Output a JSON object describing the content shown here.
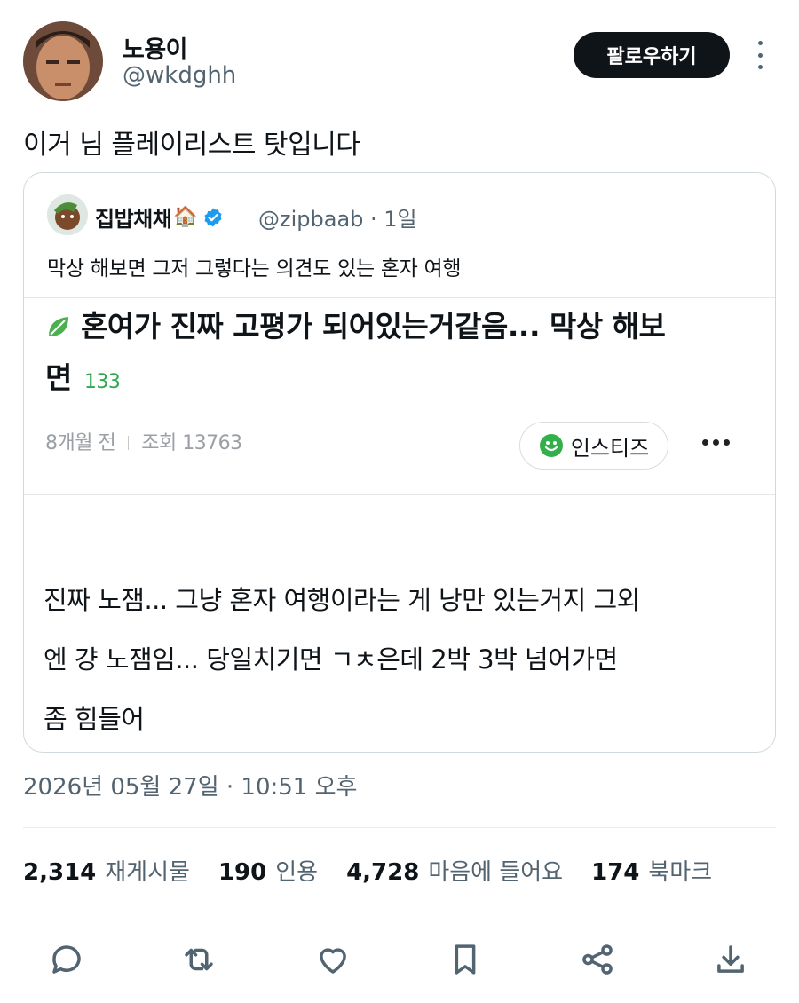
{
  "author": {
    "display_name": "노용이",
    "handle": "@wkdghh",
    "follow_label": "팔로우하기"
  },
  "tweet": {
    "text": "이거 님 플레이리스트 탓입니다",
    "timestamp": "2026년 05월 27일 · 10:51 오후"
  },
  "quote": {
    "display_name": "집밥채채",
    "house_emoji": "🏠",
    "handle_time": "@zipbaab · 1일",
    "text": "막상 해보면 그저 그렇다는 의견도 있는 혼자 여행",
    "post": {
      "title_line1": "혼여가 진짜 고평가 되어있는거같음... 막상 해보",
      "title_line2": "면",
      "comment_count": "133",
      "age": "8개월 전",
      "views": "조회 13763",
      "community_label": "인스티즈",
      "body_line1": "진짜 노잼... 그냥 혼자 여행이라는 게 낭만 있는거지 그외",
      "body_line2": "엔 걍 노잼임... 당일치기면 ㄱㅊ은데 2박 3박 넘어가면",
      "body_line3": "좀 힘들어"
    }
  },
  "stats": {
    "retweets_count": "2,314",
    "retweets_label": "재게시물",
    "quotes_count": "190",
    "quotes_label": "인용",
    "likes_count": "4,728",
    "likes_label": "마음에 들어요",
    "bookmarks_count": "174",
    "bookmarks_label": "북마크"
  },
  "icons": {
    "reply": "reply-icon",
    "retweet": "retweet-icon",
    "like": "heart-icon",
    "bookmark": "bookmark-icon",
    "share": "share-icon",
    "download": "download-icon"
  },
  "colors": {
    "verified": "#1d9bf0",
    "follow_button": "#0f1419",
    "comment_count": "#2fa84f",
    "instiz_smile": "#33b04a",
    "secondary_text": "#536471"
  }
}
